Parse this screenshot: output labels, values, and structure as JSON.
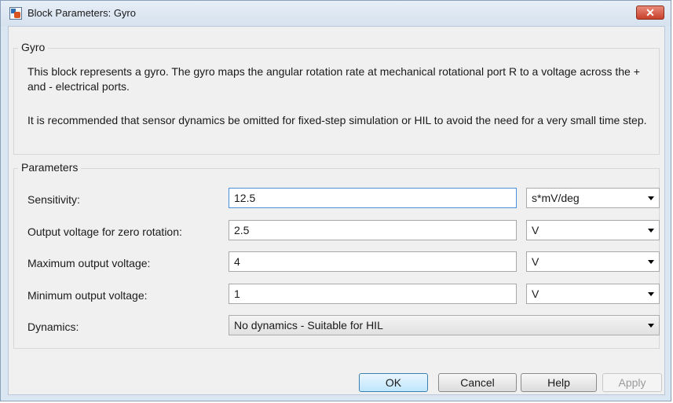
{
  "window": {
    "title": "Block Parameters: Gyro",
    "close_label": "✕"
  },
  "block_group": {
    "label": "Gyro",
    "description_1": "This block represents a gyro. The gyro maps the angular rotation rate at mechanical rotational port R to a voltage across the + and - electrical ports.",
    "description_2": "It is recommended that sensor dynamics be omitted for fixed-step simulation or HIL to avoid the need for a very small time step."
  },
  "parameters": {
    "label": "Parameters",
    "rows": [
      {
        "label": "Sensitivity:",
        "value": "12.5",
        "unit": "s*mV/deg"
      },
      {
        "label": "Output voltage for zero rotation:",
        "value": "2.5",
        "unit": "V"
      },
      {
        "label": "Maximum output voltage:",
        "value": "4",
        "unit": "V"
      },
      {
        "label": "Minimum output voltage:",
        "value": "1",
        "unit": "V"
      }
    ],
    "dynamics": {
      "label": "Dynamics:",
      "value": "No dynamics - Suitable for HIL"
    }
  },
  "buttons": {
    "ok": "OK",
    "cancel": "Cancel",
    "help": "Help",
    "apply": "Apply"
  }
}
